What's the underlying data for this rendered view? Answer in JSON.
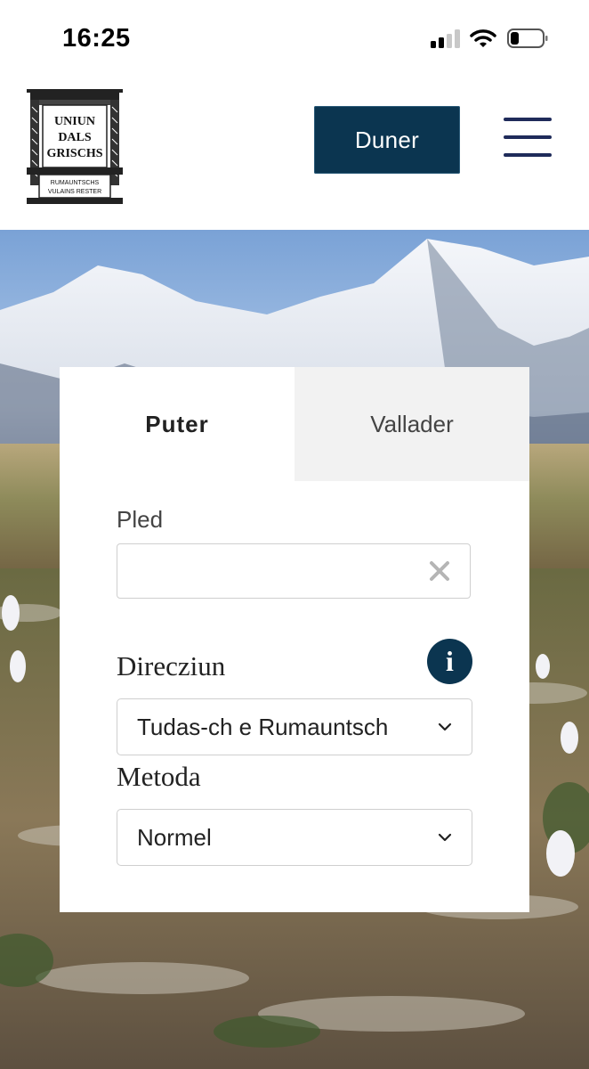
{
  "status_bar": {
    "time": "16:25",
    "battery_icon": "battery-low-icon",
    "wifi_icon": "wifi-icon",
    "signal_icon": "cellular-signal-icon"
  },
  "header": {
    "logo": {
      "line1": "UNIUN",
      "line2": "DALS",
      "line3": "GRISCHS",
      "sub1": "RUMAUNTSCHS",
      "sub2": "VULAINS RESTER"
    },
    "donate_label": "Duner",
    "menu_icon": "hamburger-menu-icon",
    "brand_color": "#0b3550"
  },
  "translator": {
    "tabs": [
      {
        "label": "Puter",
        "active": true
      },
      {
        "label": "Vallader",
        "active": false
      }
    ],
    "pled_label": "Pled",
    "pled_value": "",
    "direction_label": "Direcziun",
    "direction_value": "Tudas-ch e Rumauntsch",
    "method_label": "Metoda",
    "method_value": "Normel"
  }
}
